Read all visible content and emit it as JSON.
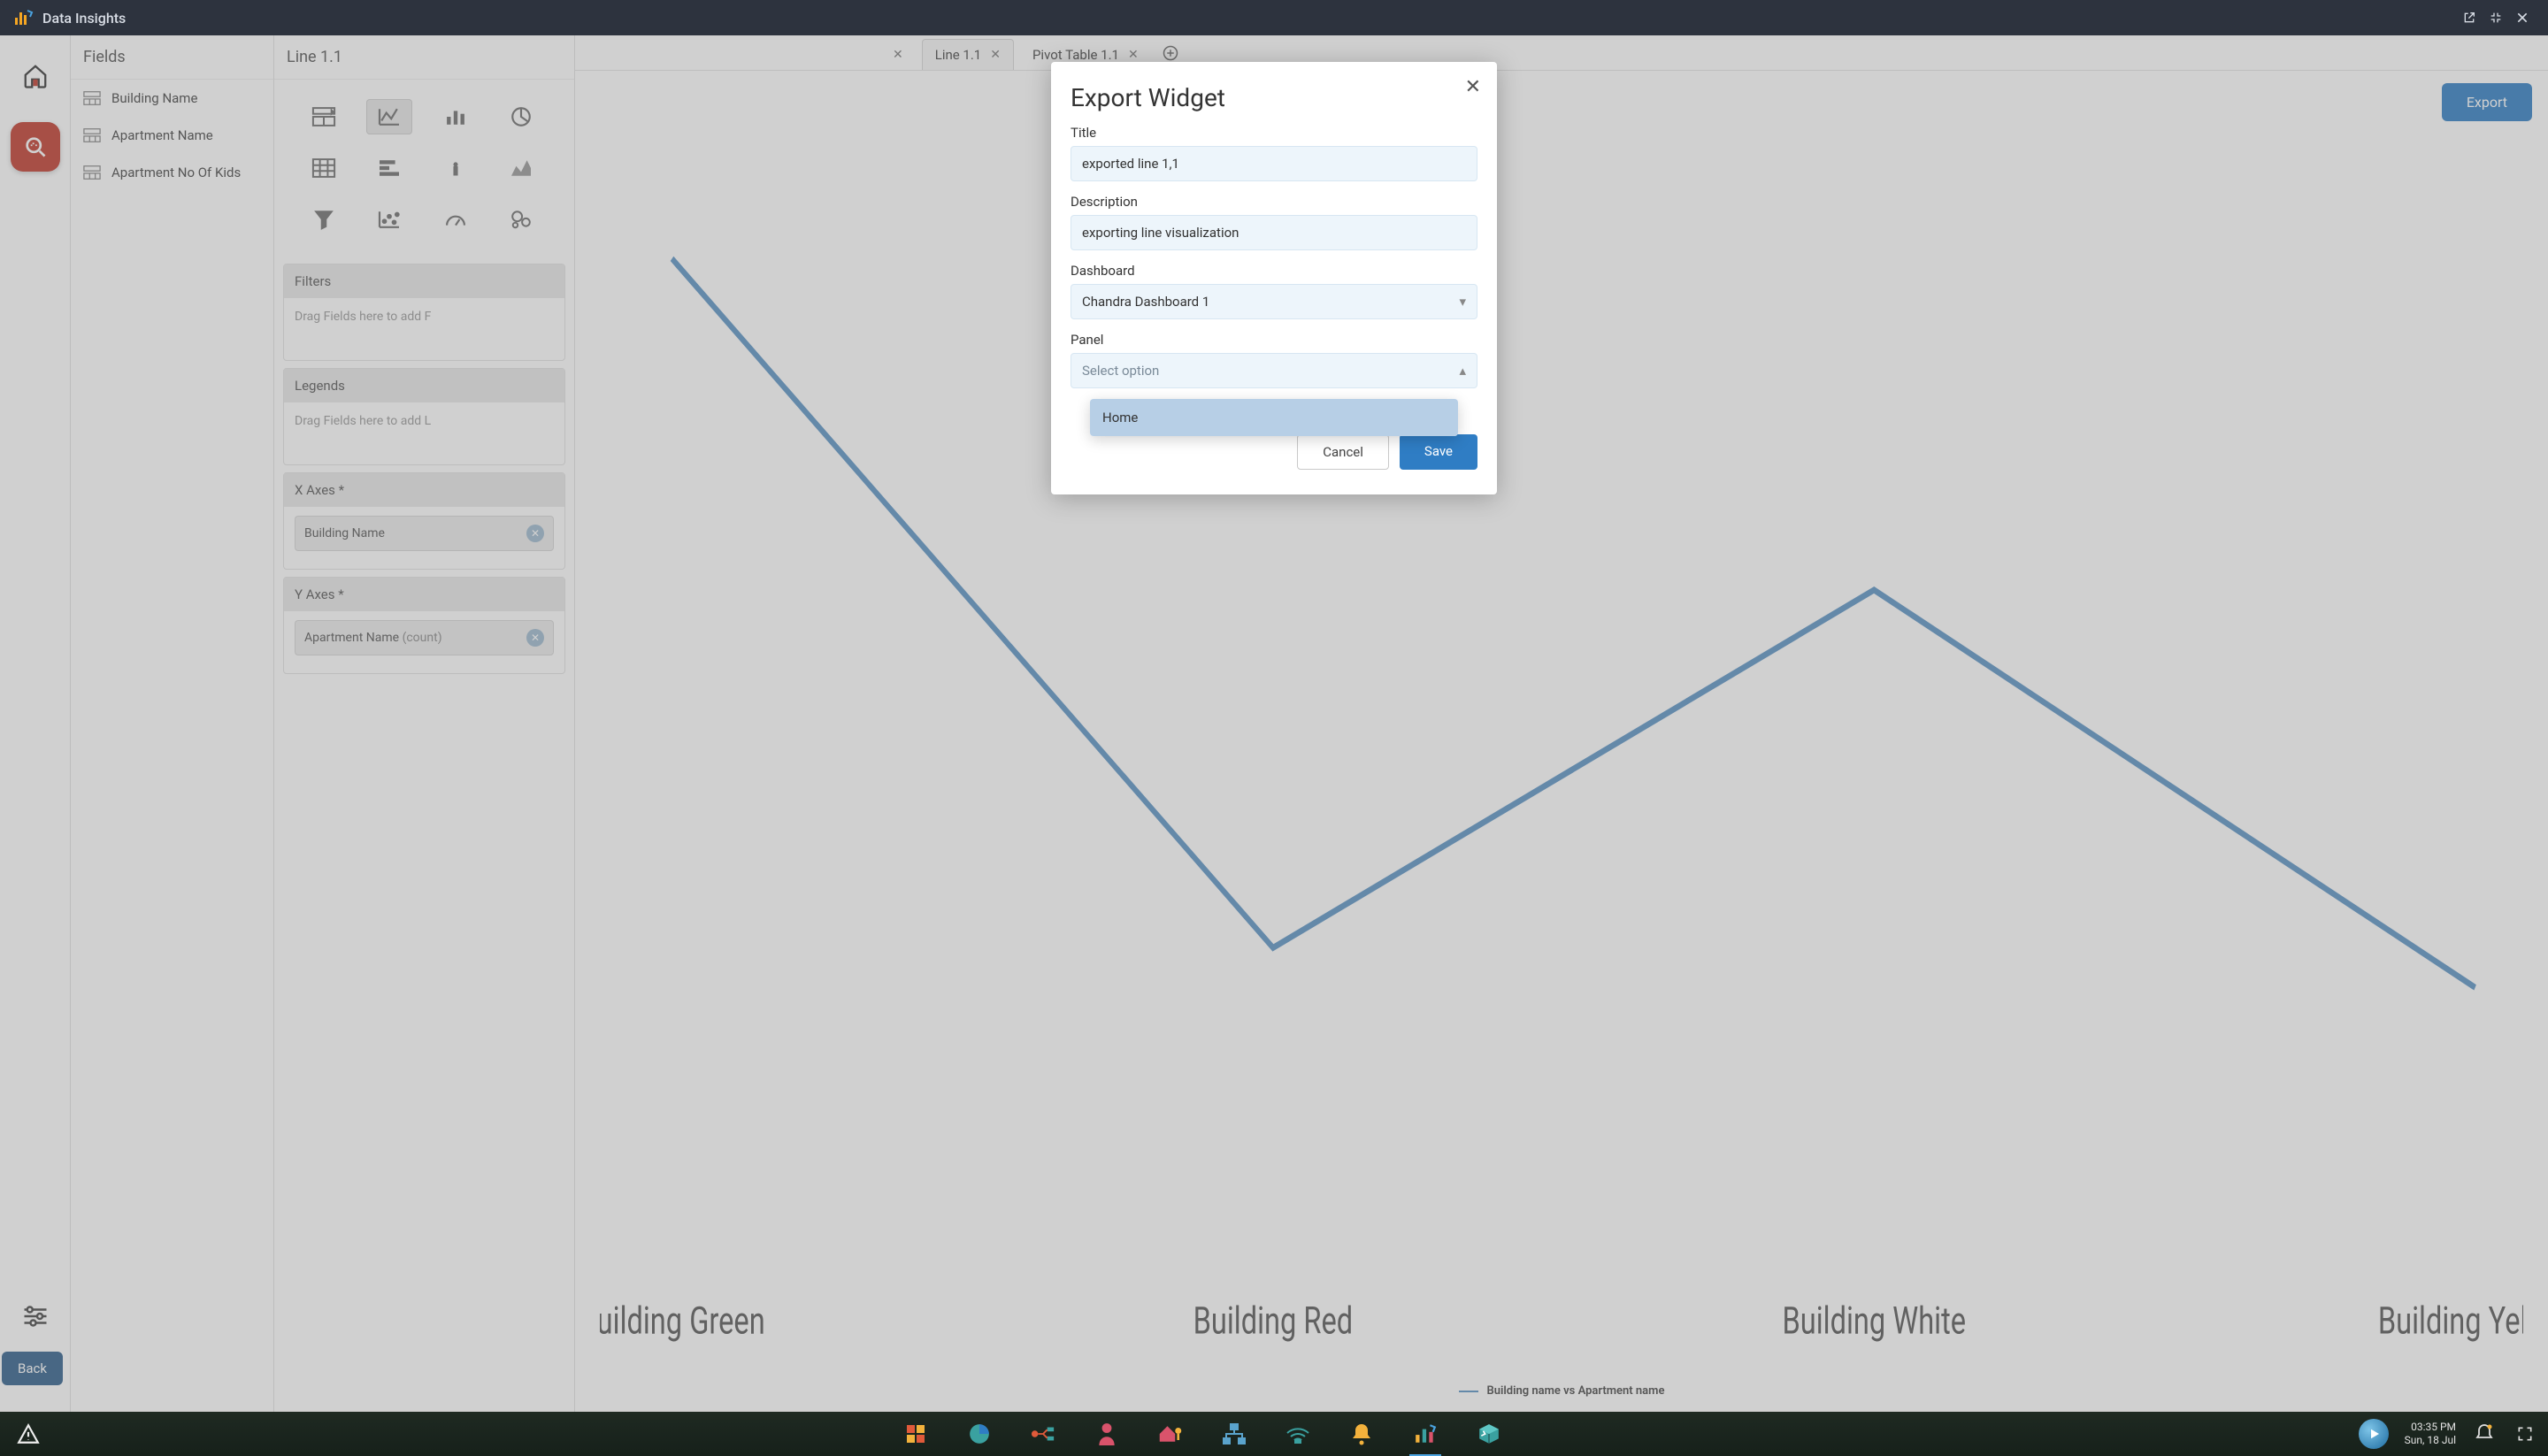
{
  "appTitle": "Data Insights",
  "fieldsPanel": {
    "header": "Fields",
    "items": [
      "Building Name",
      "Apartment Name",
      "Apartment No Of Kids"
    ]
  },
  "configPanel": {
    "header": "Line 1.1",
    "filters": {
      "title": "Filters",
      "placeholder": "Drag Fields here to add F"
    },
    "legends": {
      "title": "Legends",
      "placeholder": "Drag Fields here to add L"
    },
    "xAxes": {
      "title": "X Axes *",
      "chip": "Building Name"
    },
    "yAxes": {
      "title": "Y Axes *",
      "chip": "Apartment Name",
      "suffix": "(count)"
    }
  },
  "tabs": [
    {
      "label": "Line 1.1",
      "active": true
    },
    {
      "label": "Pivot Table 1.1",
      "active": false
    }
  ],
  "exportBtn": "Export",
  "backBtn": "Back",
  "chart_data": {
    "type": "line",
    "title": "",
    "xlabel": "",
    "ylabel": "",
    "categories": [
      "Building Green",
      "Building Red",
      "Building White",
      "Building Yellow"
    ],
    "series": [
      {
        "name": "Building name vs Apartment name",
        "values": [
          7.5,
          2.3,
          5.0,
          2.0
        ]
      }
    ],
    "ylim": [
      0,
      8
    ],
    "legend": "Building name vs Apartment name"
  },
  "modal": {
    "heading": "Export Widget",
    "titleLabel": "Title",
    "titleValue": "exported line 1,1",
    "descLabel": "Description",
    "descValue": "exporting line visualization",
    "dashboardLabel": "Dashboard",
    "dashboardValue": "Chandra Dashboard 1",
    "panelLabel": "Panel",
    "panelPlaceholder": "Select option",
    "panelOptions": [
      "Home"
    ],
    "cancel": "Cancel",
    "save": "Save"
  },
  "taskbar": {
    "time": "03:35 PM",
    "date": "Sun, 18 Jul"
  }
}
